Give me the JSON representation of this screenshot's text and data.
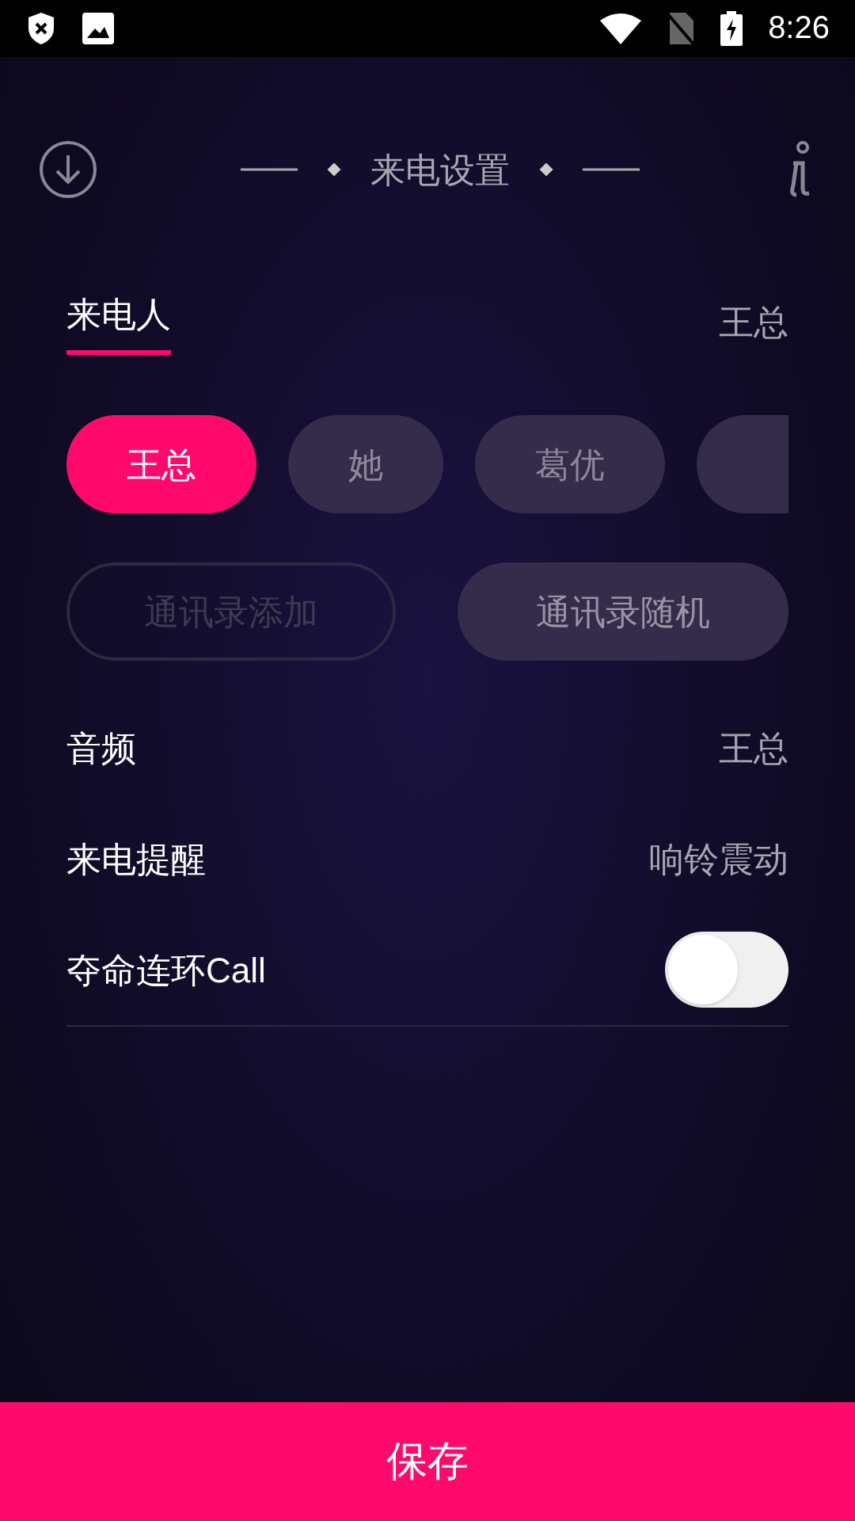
{
  "status_bar": {
    "time": "8:26"
  },
  "header": {
    "title": "来电设置"
  },
  "caller_tab": {
    "label": "来电人",
    "selected": true,
    "value": "王总"
  },
  "chips": [
    {
      "label": "王总",
      "selected": true
    },
    {
      "label": "她",
      "selected": false
    },
    {
      "label": "葛优",
      "selected": false
    },
    {
      "selected": false
    }
  ],
  "contact_buttons": [
    {
      "label": "通讯录添加",
      "disabled": true
    },
    {
      "label": "通讯录随机",
      "disabled": false
    }
  ],
  "settings": [
    {
      "kind": "value",
      "label": "音频",
      "value": "王总"
    },
    {
      "kind": "value",
      "label": "来电提醒",
      "value": "响铃震动"
    },
    {
      "kind": "toggle",
      "label": "夺命连环Call",
      "on": false
    }
  ],
  "save_button": {
    "label": "保存"
  }
}
